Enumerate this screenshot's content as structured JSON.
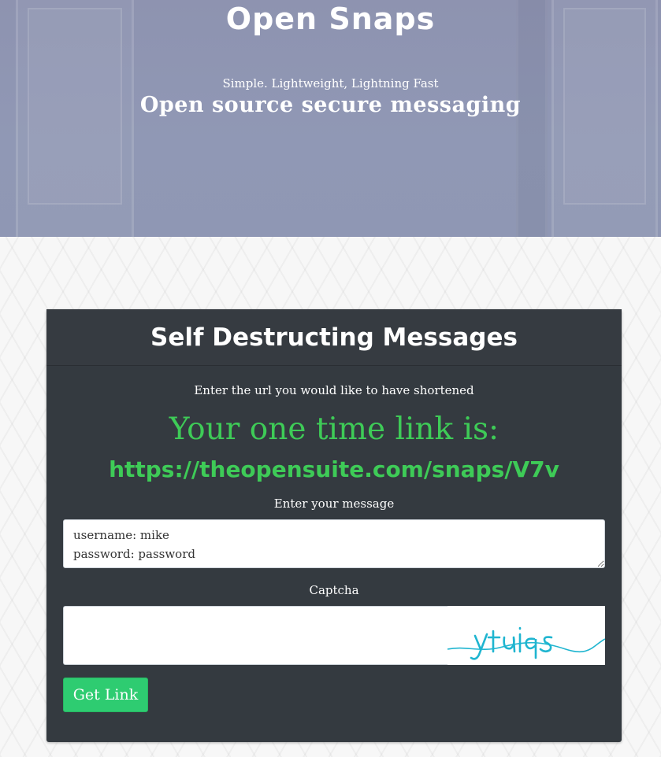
{
  "hero": {
    "title": "Open Snaps",
    "tagline": "Simple. Lightweight, Lightning Fast",
    "subtitle": "Open source secure messaging"
  },
  "card": {
    "title": "Self Destructing Messages",
    "intro": "Enter the url you would like to have shortened",
    "link_heading": "Your one time link is:",
    "link_url": "https://theopensuite.com/snaps/V7v",
    "message_label": "Enter your message",
    "message_value": "username: mike\npassword: password",
    "captcha_label": "Captcha",
    "captcha_value": "",
    "captcha_image_text": "yauqs",
    "button_label": "Get Link"
  },
  "colors": {
    "link_green": "#3ecb57",
    "button_green": "#2ecc71",
    "card_bg": "#343a40",
    "captcha_cyan": "#1fb5d0"
  }
}
